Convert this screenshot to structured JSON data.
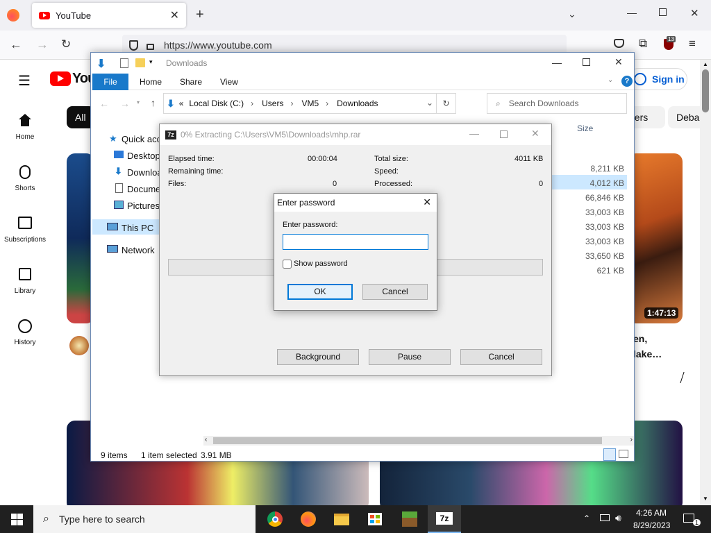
{
  "browser": {
    "tab_title": "YouTube",
    "url": "https://www.youtube.com",
    "extension_badge": "13"
  },
  "youtube": {
    "logo_text": "You",
    "sign_in": "Sign in",
    "chip_all": "All",
    "chip_right_1": "gers",
    "chip_right_2": "Deba",
    "nav": [
      "Home",
      "Shorts",
      "Subscriptions",
      "Library",
      "History"
    ],
    "video_duration": "1:47:13",
    "video_title_line1": "en,",
    "video_title_line2": "lake…"
  },
  "explorer": {
    "title": "Downloads",
    "ribbon_tabs": [
      "File",
      "Home",
      "Share",
      "View"
    ],
    "breadcrumb": [
      "Local Disk (C:)",
      "Users",
      "VM5",
      "Downloads"
    ],
    "breadcrumb_prefix": "«",
    "search_placeholder": "Search Downloads",
    "nav_items": [
      "Quick acce",
      "Desktop",
      "Downloa",
      "Documen",
      "Pictures",
      "This PC",
      "Network"
    ],
    "size_header": "Size",
    "sizes": [
      "8,211 KB",
      "4,012 KB",
      "66,846 KB",
      "33,003 KB",
      "33,003 KB",
      "33,003 KB",
      "33,650 KB",
      "621 KB"
    ],
    "status_items": "9 items",
    "status_selected": "1 item selected",
    "status_size": "3.91 MB"
  },
  "zip": {
    "title": "0% Extracting C:\\Users\\VM5\\Downloads\\mhp.rar",
    "elapsed_label": "Elapsed time:",
    "elapsed_value": "00:00:04",
    "remaining_label": "Remaining time:",
    "files_label": "Files:",
    "files_value": "0",
    "total_label": "Total size:",
    "total_value": "4011 KB",
    "speed_label": "Speed:",
    "processed_label": "Processed:",
    "processed_value": "0",
    "progress": 0,
    "btn_background": "Background",
    "btn_pause": "Pause",
    "btn_cancel": "Cancel"
  },
  "password": {
    "title": "Enter password",
    "label": "Enter password:",
    "value": "",
    "show_label": "Show password",
    "show_checked": false,
    "ok": "OK",
    "cancel": "Cancel"
  },
  "taskbar": {
    "search_placeholder": "Type here to search",
    "time": "4:26 AM",
    "date": "8/29/2023",
    "notification_count": "1"
  }
}
